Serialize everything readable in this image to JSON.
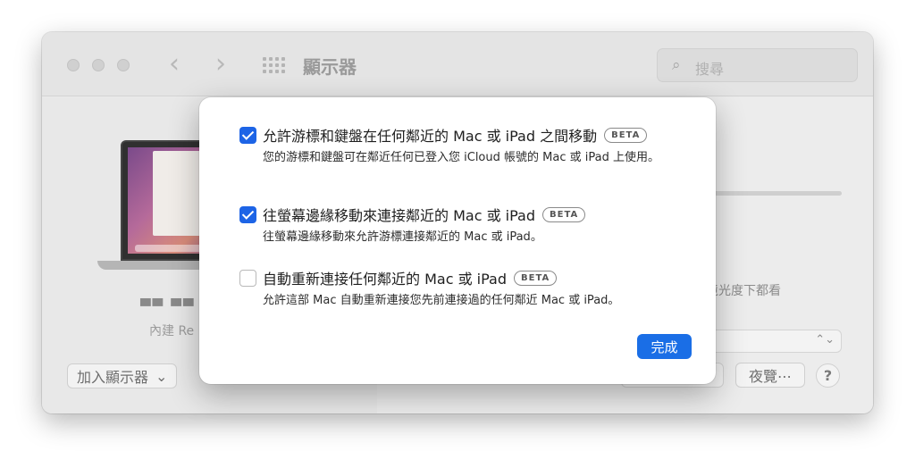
{
  "window": {
    "title": "顯示器",
    "search_placeholder": "搜尋"
  },
  "left": {
    "display_name": "▀▀ ▀▀",
    "display_sub": "內建 Re",
    "add_display_label": "加入顯示器",
    "add_display_arrow": "⌄"
  },
  "right": {
    "ambient_text": "的環境光度下都看",
    "ambient_text2": "",
    "preview_label": "夜覽⋯",
    "help_label": "?"
  },
  "sheet": {
    "options": [
      {
        "checked": true,
        "title": "允許游標和鍵盤在任何鄰近的 Mac 或 iPad 之間移動",
        "badge": "BETA",
        "desc": "您的游標和鍵盤可在鄰近任何已登入您 iCloud 帳號的 Mac 或 iPad 上使用。"
      },
      {
        "checked": true,
        "title": "往螢幕邊緣移動來連接鄰近的 Mac 或 iPad",
        "badge": "BETA",
        "desc": "往螢幕邊緣移動來允許游標連接鄰近的 Mac 或 iPad。"
      },
      {
        "checked": false,
        "title": "自動重新連接任何鄰近的 Mac 或 iPad",
        "badge": "BETA",
        "desc": "允許這部 Mac 自動重新連接您先前連接過的任何鄰近 Mac 或 iPad。"
      }
    ],
    "done_label": "完成"
  },
  "colors": {
    "accent": "#1a6ee6",
    "checkbox_on": "#1d64e6"
  }
}
